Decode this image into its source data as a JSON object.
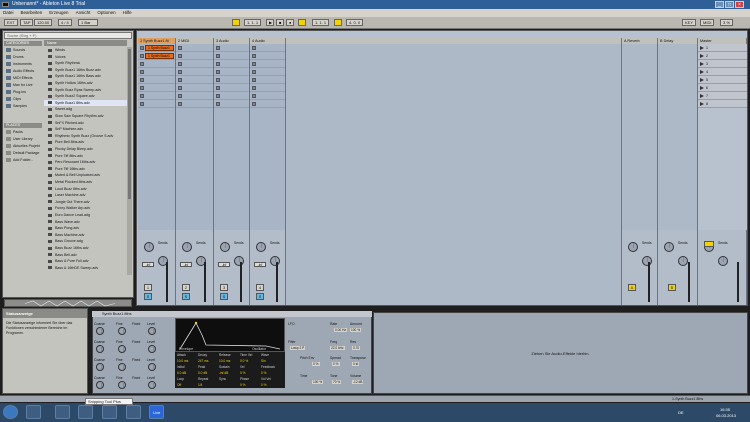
{
  "window": {
    "title": "Unbenannt* - Ableton Live 8 Trial",
    "controls": [
      "_",
      "□",
      "×"
    ]
  },
  "menu": [
    "Datei",
    "Bearbeiten",
    "Erzeugen",
    "Ansicht",
    "Optionen",
    "Hilfe"
  ],
  "transport": {
    "tap": "TAP",
    "tempo": "120.00",
    "signature": "4 / 4",
    "quant": "1 Bar",
    "position": "1. 1. 1",
    "loop_start": "1. 1. 1",
    "loop_len": "4. 0. 0",
    "key": "KEY",
    "midi": "MIDI",
    "cpu": "3 %"
  },
  "browser": {
    "search_placeholder": "Suche (Strg + F)",
    "categories_header": "CATEGORIES",
    "categories": [
      "Sounds",
      "Drums",
      "Instruments",
      "Audio Effects",
      "MIDI Effects",
      "Max for Live",
      "Plug-ins",
      "Clips",
      "Samples"
    ],
    "places_header": "PLACES",
    "places": [
      "Packs",
      "User Library",
      "Aktuelles Projekt",
      "Default Package",
      "Add Folder..."
    ],
    "name_header": "Name",
    "files": [
      "Winds",
      "Voices",
      "Synth Rhythmic",
      "Synth Buzz1 16ths Buzz.adv",
      "Synth Buzz1 16ths Bass.adv",
      "Synth Hollow 16ths.adv",
      "Synth Buzz Ryas Sweep.adv",
      "Synth Buzz2 Square.adv",
      "Synth Buzz1 8ths.adv",
      "Sweet.adg",
      "Slow Saw Square Rhythm.adv",
      "SnFX Pitched.adv",
      "SnP Machine.adv",
      "Rhythmic Synth Buzz (Groove S.adv",
      "Pure Bell 8ths.adv",
      "Plucky Delay Bleep.adv",
      "Pure Tiff 8ths.adv",
      "Perc Resonant 16ths.adv",
      "Pure Tiff 16ths.adv",
      "Muted & Bell Unplucked.adv",
      "Metal Plucked 8ths.adv",
      "Loud Buzz 8ths.adv",
      "Laser Machine.adv",
      "Jungle Out There.adv",
      "Funny Walker Arp.adv",
      "Euro Dance Lead.adg",
      "Bass Wave.adv",
      "Bass Pong.adv",
      "Bass Machine.adv",
      "Bass Groove.adg",
      "Bass Buzz 16ths.adv",
      "Bass Bell.adv",
      "Bass & Pure Full.adv",
      "Bass & 16thDE Sweep.adv"
    ],
    "selected_index": 8
  },
  "tracks": [
    {
      "name": "1 Synth Buzz1 8t",
      "clips": [
        "1 Synth Buzz1",
        "1 Synth Buzz1"
      ]
    },
    {
      "name": "2 MIDI",
      "clips": []
    },
    {
      "name": "3 Audio",
      "clips": []
    },
    {
      "name": "4 Audio",
      "clips": []
    }
  ],
  "returns": [
    {
      "name": "A Reverb",
      "button": "A"
    },
    {
      "name": "B Delay",
      "button": "B"
    }
  ],
  "master": {
    "name": "Master",
    "scenes": [
      "1",
      "2",
      "3",
      "4",
      "5",
      "6",
      "7",
      "8"
    ]
  },
  "drop_hint": "Ziehen Sie Dateien und Geräte hierhin.",
  "mixer": {
    "sends_label": "Sends",
    "volume_values": [
      "-inf",
      "-inf",
      "-inf",
      "-inf"
    ],
    "meter_ticks": [
      "0",
      "6",
      "12",
      "24",
      "36",
      "48",
      "60"
    ],
    "track_numbers": [
      "1",
      "2",
      "3",
      "4"
    ],
    "solo": "S",
    "master_vol": "0"
  },
  "info": {
    "title": "Statusanzeige",
    "text": "Die Statusanzeige informiert Sie über das Funktionen verschiedener Bereiche im Programm."
  },
  "device": {
    "title": "Synth Buzz1 8ths",
    "osc_rows": [
      {
        "label": "Coarse",
        "f1": "Fine",
        "f2": "Fixed",
        "f3": "Level"
      },
      {
        "label": "Coarse",
        "f1": "Fine",
        "f2": "Fixed",
        "f3": "Level"
      },
      {
        "label": "Coarse",
        "f1": "Fine",
        "f2": "Fixed",
        "f3": "Level"
      },
      {
        "label": "Coarse",
        "f1": "Fine",
        "f2": "Fixed",
        "f3": "Level"
      }
    ],
    "envelope_label": "Envelope",
    "oscillator_label": "Oscillator",
    "env_params": [
      [
        "Attack",
        "Decay",
        "Release",
        "Time Vel",
        "Wave"
      ],
      [
        "10.0 ms",
        "247 ms",
        "10.0 ms",
        "0.0 %",
        "Sin"
      ],
      [
        "Initial",
        "Peak",
        "Sustain",
        "Vel",
        "Feedback"
      ],
      [
        "0.0 dB",
        "0.0 dB",
        "-inf dB",
        "0 %",
        "0 %"
      ],
      [
        "Loop",
        "Repeat",
        "Sync",
        "Phase",
        "Vol Vel"
      ],
      [
        "Off",
        "1/4",
        "",
        "0 %",
        "0 %"
      ]
    ],
    "filter": {
      "lfo": "LFO",
      "rate": "Rate",
      "amount": "Amount",
      "filter": "Filter",
      "freq": "Freq",
      "res": "Res",
      "pitch_env": "Pitch Env",
      "spread": "Spread",
      "transpose": "Transpose",
      "time": "Time",
      "tone": "Tone",
      "volume": "Volume",
      "vals": [
        "0.00 Hz",
        "100 %",
        "Lowp 2 P",
        "22.0 kHz",
        "0.70",
        "0 %",
        "0 %",
        "0 st",
        "100 %",
        "70 %",
        "-12 dB"
      ]
    }
  },
  "device_drop_hint": "Ziehen Sie Audio-Effekte hierhin.",
  "status": {
    "track_label": "1-Synth Buzz1 8ths"
  },
  "tooltip": "Snipping Tool Plus",
  "clock": {
    "time": "16:35",
    "date": "06.03.2013",
    "lang": "DE"
  }
}
